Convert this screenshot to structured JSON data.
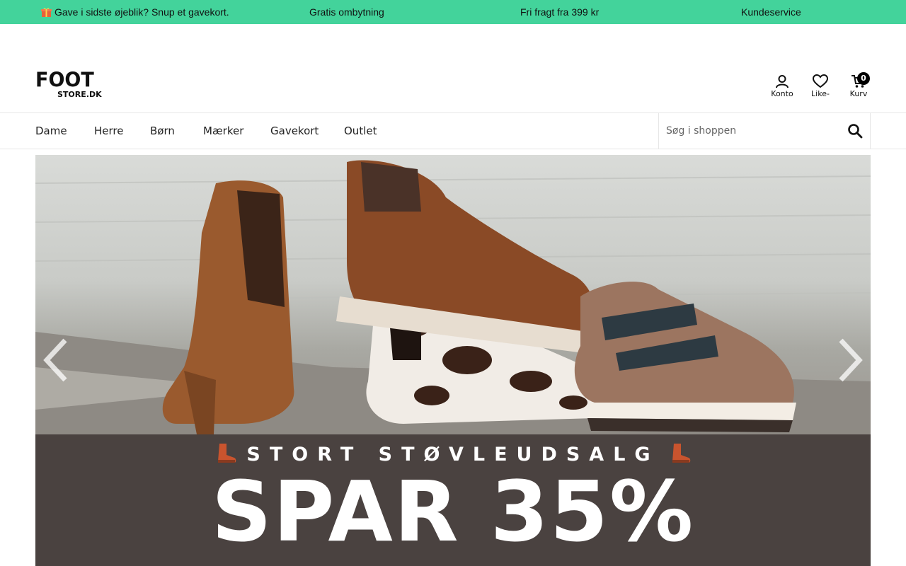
{
  "topbar": {
    "items": [
      "Gave i sidste øjeblik? Snup et gavekort.",
      "Gratis ombytning",
      "Fri fragt fra 399 kr",
      "Kundeservice"
    ]
  },
  "logo": {
    "line1": "FOOT",
    "line2": "STORE.DK"
  },
  "header": {
    "account_label": "Konto",
    "likes_label": "Like-",
    "cart_label": "Kurv",
    "cart_count": "0"
  },
  "nav": {
    "items": [
      "Dame",
      "Herre",
      "Børn",
      "Mærker",
      "Gavekort",
      "Outlet"
    ]
  },
  "search": {
    "placeholder": "Søg i shoppen"
  },
  "hero": {
    "subtitle": "STORT STØVLEUDSALG",
    "headline": "SPAR 35%"
  },
  "colors": {
    "accent": "#43d39b",
    "band": "#4a4240",
    "text": "#111111"
  },
  "icons": {
    "gift": "gift-icon",
    "account": "user-icon",
    "likes": "heart-icon",
    "cart": "cart-icon",
    "search": "search-icon",
    "boot": "boot-icon",
    "prev": "chevron-left-icon",
    "next": "chevron-right-icon"
  }
}
